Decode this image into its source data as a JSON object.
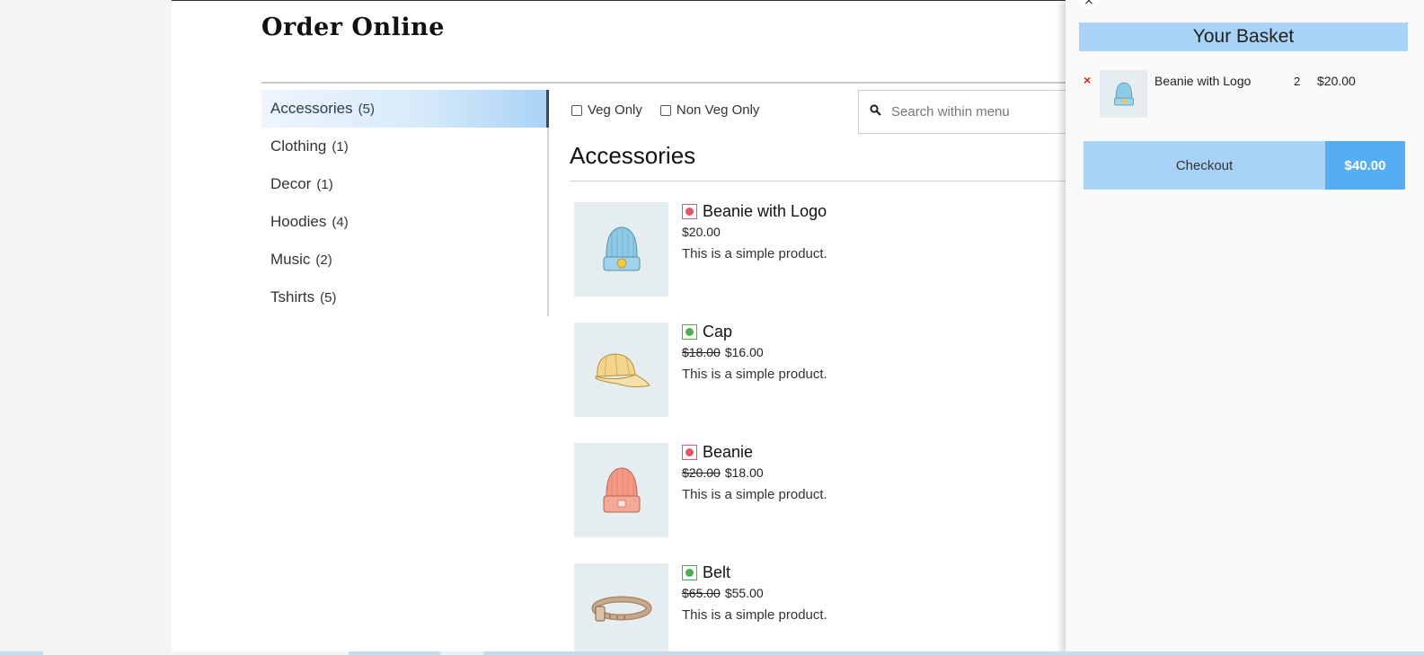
{
  "page": {
    "title": "Order Online"
  },
  "categories": [
    {
      "label": "Accessories",
      "count": "(5)",
      "active": true
    },
    {
      "label": "Clothing",
      "count": "(1)"
    },
    {
      "label": "Decor",
      "count": "(1)"
    },
    {
      "label": "Hoodies",
      "count": "(4)"
    },
    {
      "label": "Music",
      "count": "(2)"
    },
    {
      "label": "Tshirts",
      "count": "(5)"
    }
  ],
  "filters": {
    "veg_label": "Veg Only",
    "nonveg_label": "Non Veg Only"
  },
  "search": {
    "placeholder": "Search within menu"
  },
  "section": {
    "title": "Accessories"
  },
  "products": [
    {
      "name": "Beanie with Logo",
      "diet": "nonveg",
      "old_price": "",
      "price": "$20.00",
      "description": "This is a simple product.",
      "icon": "beanie-logo-icon"
    },
    {
      "name": "Cap",
      "diet": "veg",
      "old_price": "$18.00",
      "price": "$16.00",
      "description": "This is a simple product.",
      "icon": "cap-icon"
    },
    {
      "name": "Beanie",
      "diet": "nonveg",
      "old_price": "$20.00",
      "price": "$18.00",
      "description": "This is a simple product.",
      "icon": "beanie-icon"
    },
    {
      "name": "Belt",
      "diet": "veg",
      "old_price": "$65.00",
      "price": "$55.00",
      "description": "This is a simple product.",
      "icon": "belt-icon"
    }
  ],
  "basket": {
    "title": "Your Basket",
    "close_glyph": "×",
    "items": [
      {
        "remove_glyph": "×",
        "name": "Beanie with Logo",
        "qty": "2",
        "price": "$20.00"
      }
    ],
    "checkout_label": "Checkout",
    "total": "$40.00"
  },
  "colors": {
    "accent": "#a9d3f6",
    "accent_strong": "#55aef2",
    "veg": "#4caf50",
    "nonveg": "#e8546a",
    "remove": "#e02020"
  }
}
